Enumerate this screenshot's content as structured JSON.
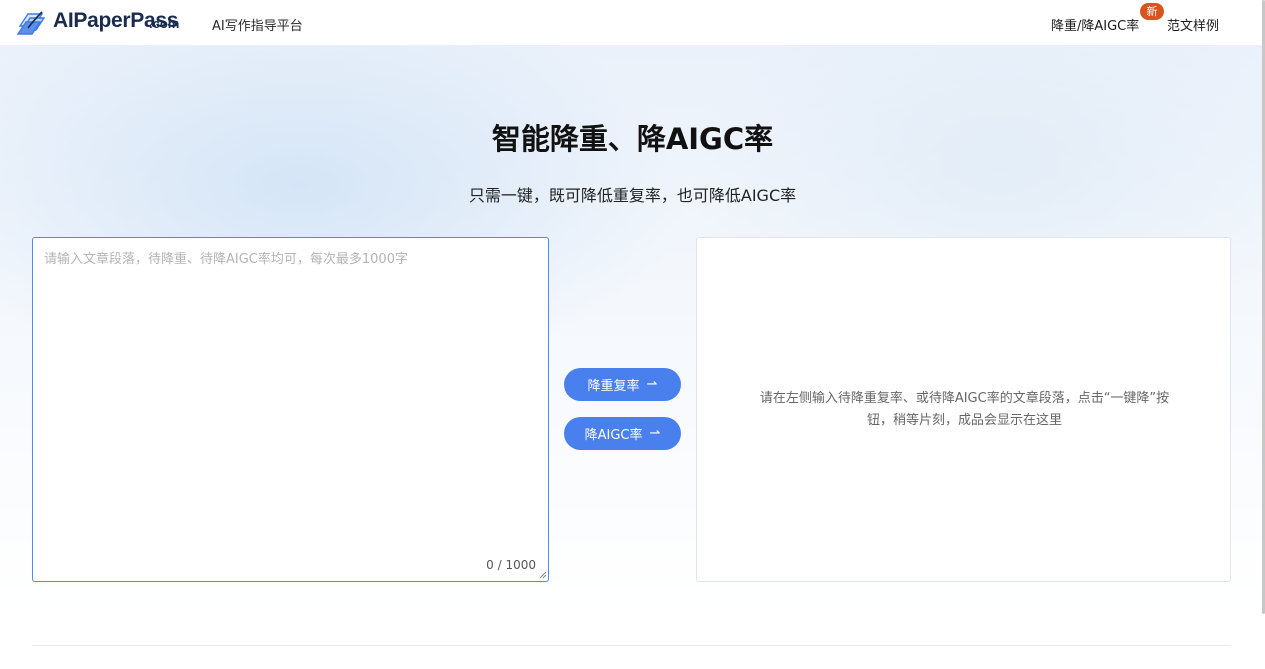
{
  "header": {
    "brand_name": "AIPaperPass",
    "brand_suffix": ".com",
    "tagline": "AI写作指导平台",
    "nav": [
      {
        "label": "降重/降AIGC率",
        "badge": "新"
      },
      {
        "label": "范文样例"
      }
    ]
  },
  "hero": {
    "title": "智能降重、降AIGC率",
    "subtitle": "只需一键，既可降低重复率，也可降低AIGC率"
  },
  "input": {
    "placeholder": "请输入文章段落，待降重、待降AIGC率均可，每次最多1000字",
    "value": "",
    "char_count": "0 / 1000"
  },
  "actions": {
    "reduce_rate_label": "降重复率",
    "reduce_aigc_label": "降AIGC率",
    "arrow": "⇀"
  },
  "output": {
    "hint": "请在左侧输入待降重复率、或待降AIGC率的文章段落，点击“一键降”按钮，稍等片刻，成品会显示在这里"
  },
  "colors": {
    "primary": "#4a80ee",
    "badge": "#d8541e",
    "brand_text": "#1a2c4d"
  }
}
